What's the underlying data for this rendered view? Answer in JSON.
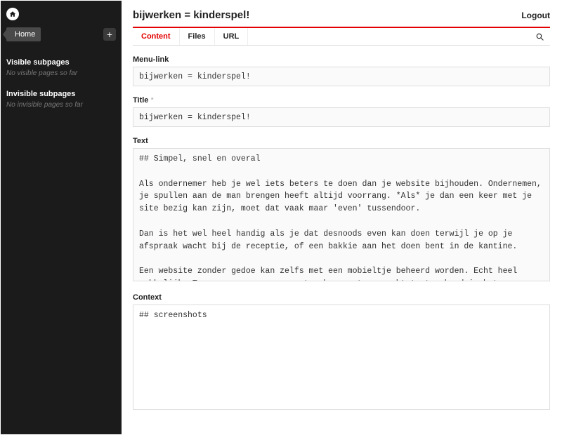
{
  "sidebar": {
    "crumb": "Home",
    "sections": [
      {
        "title": "Visible subpages",
        "empty": "No visible pages so far"
      },
      {
        "title": "Invisible subpages",
        "empty": "No invisible pages so far"
      }
    ]
  },
  "header": {
    "title": "bijwerken = kinderspel!",
    "logout": "Logout"
  },
  "tabs": [
    {
      "label": "Content",
      "active": true
    },
    {
      "label": "Files",
      "active": false
    },
    {
      "label": "URL",
      "active": false
    }
  ],
  "fields": {
    "menulink": {
      "label": "Menu-link",
      "value": "bijwerken = kinderspel!"
    },
    "title": {
      "label": "Title",
      "required": "*",
      "value": "bijwerken = kinderspel!"
    },
    "text": {
      "label": "Text",
      "value": "## Simpel, snel en overal\n\nAls ondernemer heb je wel iets beters te doen dan je website bijhouden. Ondernemen, je spullen aan de man brengen heeft altijd voorrang. *Als* je dan een keer met je site bezig kan zijn, moet dat vaak maar 'even' tussendoor.\n\nDan is het wel heel handig als je dat desnoods even kan doen terwijl je op je afspraak wacht bij de receptie, of een bakkie aan het doen bent in de kantine.\n\nEen website zonder gedoe kan zelfs met een mobieltje beheerd worden. Echt heel makkelijk. Toegegeven, op een groot scherm met een echt toetsenbord is het comfortabeler, maar het *kan*, en het *werkt*.\n\nOm al dit moois mogelijk te maken, hebben we gekozen voor een CMSje zonder gedoe: (link: http://getkirby.com text: Kirby class: new-window). Kijk op de screenshots hoe het eruit ziet."
    },
    "context": {
      "label": "Context",
      "value": "## screenshots"
    }
  }
}
